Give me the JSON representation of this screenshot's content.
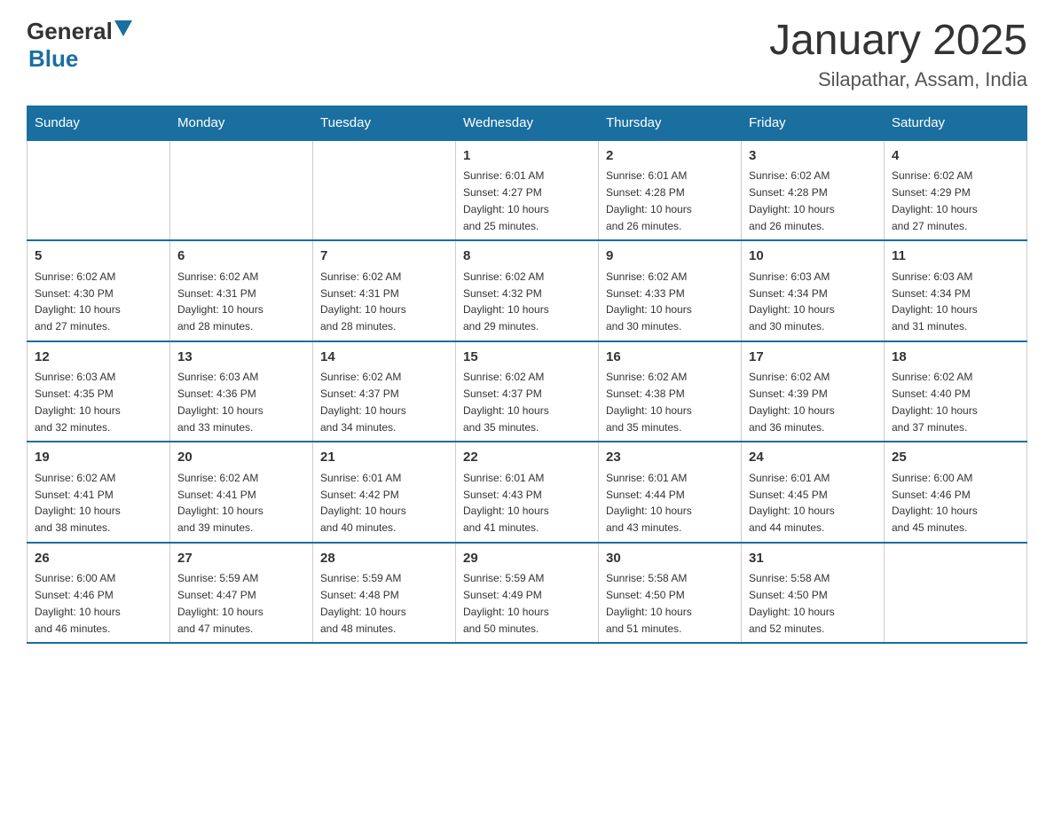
{
  "header": {
    "logo_general": "General",
    "logo_blue": "Blue",
    "title": "January 2025",
    "subtitle": "Silapathar, Assam, India"
  },
  "calendar": {
    "days_of_week": [
      "Sunday",
      "Monday",
      "Tuesday",
      "Wednesday",
      "Thursday",
      "Friday",
      "Saturday"
    ],
    "weeks": [
      [
        {
          "day": "",
          "info": ""
        },
        {
          "day": "",
          "info": ""
        },
        {
          "day": "",
          "info": ""
        },
        {
          "day": "1",
          "info": "Sunrise: 6:01 AM\nSunset: 4:27 PM\nDaylight: 10 hours\nand 25 minutes."
        },
        {
          "day": "2",
          "info": "Sunrise: 6:01 AM\nSunset: 4:28 PM\nDaylight: 10 hours\nand 26 minutes."
        },
        {
          "day": "3",
          "info": "Sunrise: 6:02 AM\nSunset: 4:28 PM\nDaylight: 10 hours\nand 26 minutes."
        },
        {
          "day": "4",
          "info": "Sunrise: 6:02 AM\nSunset: 4:29 PM\nDaylight: 10 hours\nand 27 minutes."
        }
      ],
      [
        {
          "day": "5",
          "info": "Sunrise: 6:02 AM\nSunset: 4:30 PM\nDaylight: 10 hours\nand 27 minutes."
        },
        {
          "day": "6",
          "info": "Sunrise: 6:02 AM\nSunset: 4:31 PM\nDaylight: 10 hours\nand 28 minutes."
        },
        {
          "day": "7",
          "info": "Sunrise: 6:02 AM\nSunset: 4:31 PM\nDaylight: 10 hours\nand 28 minutes."
        },
        {
          "day": "8",
          "info": "Sunrise: 6:02 AM\nSunset: 4:32 PM\nDaylight: 10 hours\nand 29 minutes."
        },
        {
          "day": "9",
          "info": "Sunrise: 6:02 AM\nSunset: 4:33 PM\nDaylight: 10 hours\nand 30 minutes."
        },
        {
          "day": "10",
          "info": "Sunrise: 6:03 AM\nSunset: 4:34 PM\nDaylight: 10 hours\nand 30 minutes."
        },
        {
          "day": "11",
          "info": "Sunrise: 6:03 AM\nSunset: 4:34 PM\nDaylight: 10 hours\nand 31 minutes."
        }
      ],
      [
        {
          "day": "12",
          "info": "Sunrise: 6:03 AM\nSunset: 4:35 PM\nDaylight: 10 hours\nand 32 minutes."
        },
        {
          "day": "13",
          "info": "Sunrise: 6:03 AM\nSunset: 4:36 PM\nDaylight: 10 hours\nand 33 minutes."
        },
        {
          "day": "14",
          "info": "Sunrise: 6:02 AM\nSunset: 4:37 PM\nDaylight: 10 hours\nand 34 minutes."
        },
        {
          "day": "15",
          "info": "Sunrise: 6:02 AM\nSunset: 4:37 PM\nDaylight: 10 hours\nand 35 minutes."
        },
        {
          "day": "16",
          "info": "Sunrise: 6:02 AM\nSunset: 4:38 PM\nDaylight: 10 hours\nand 35 minutes."
        },
        {
          "day": "17",
          "info": "Sunrise: 6:02 AM\nSunset: 4:39 PM\nDaylight: 10 hours\nand 36 minutes."
        },
        {
          "day": "18",
          "info": "Sunrise: 6:02 AM\nSunset: 4:40 PM\nDaylight: 10 hours\nand 37 minutes."
        }
      ],
      [
        {
          "day": "19",
          "info": "Sunrise: 6:02 AM\nSunset: 4:41 PM\nDaylight: 10 hours\nand 38 minutes."
        },
        {
          "day": "20",
          "info": "Sunrise: 6:02 AM\nSunset: 4:41 PM\nDaylight: 10 hours\nand 39 minutes."
        },
        {
          "day": "21",
          "info": "Sunrise: 6:01 AM\nSunset: 4:42 PM\nDaylight: 10 hours\nand 40 minutes."
        },
        {
          "day": "22",
          "info": "Sunrise: 6:01 AM\nSunset: 4:43 PM\nDaylight: 10 hours\nand 41 minutes."
        },
        {
          "day": "23",
          "info": "Sunrise: 6:01 AM\nSunset: 4:44 PM\nDaylight: 10 hours\nand 43 minutes."
        },
        {
          "day": "24",
          "info": "Sunrise: 6:01 AM\nSunset: 4:45 PM\nDaylight: 10 hours\nand 44 minutes."
        },
        {
          "day": "25",
          "info": "Sunrise: 6:00 AM\nSunset: 4:46 PM\nDaylight: 10 hours\nand 45 minutes."
        }
      ],
      [
        {
          "day": "26",
          "info": "Sunrise: 6:00 AM\nSunset: 4:46 PM\nDaylight: 10 hours\nand 46 minutes."
        },
        {
          "day": "27",
          "info": "Sunrise: 5:59 AM\nSunset: 4:47 PM\nDaylight: 10 hours\nand 47 minutes."
        },
        {
          "day": "28",
          "info": "Sunrise: 5:59 AM\nSunset: 4:48 PM\nDaylight: 10 hours\nand 48 minutes."
        },
        {
          "day": "29",
          "info": "Sunrise: 5:59 AM\nSunset: 4:49 PM\nDaylight: 10 hours\nand 50 minutes."
        },
        {
          "day": "30",
          "info": "Sunrise: 5:58 AM\nSunset: 4:50 PM\nDaylight: 10 hours\nand 51 minutes."
        },
        {
          "day": "31",
          "info": "Sunrise: 5:58 AM\nSunset: 4:50 PM\nDaylight: 10 hours\nand 52 minutes."
        },
        {
          "day": "",
          "info": ""
        }
      ]
    ]
  }
}
